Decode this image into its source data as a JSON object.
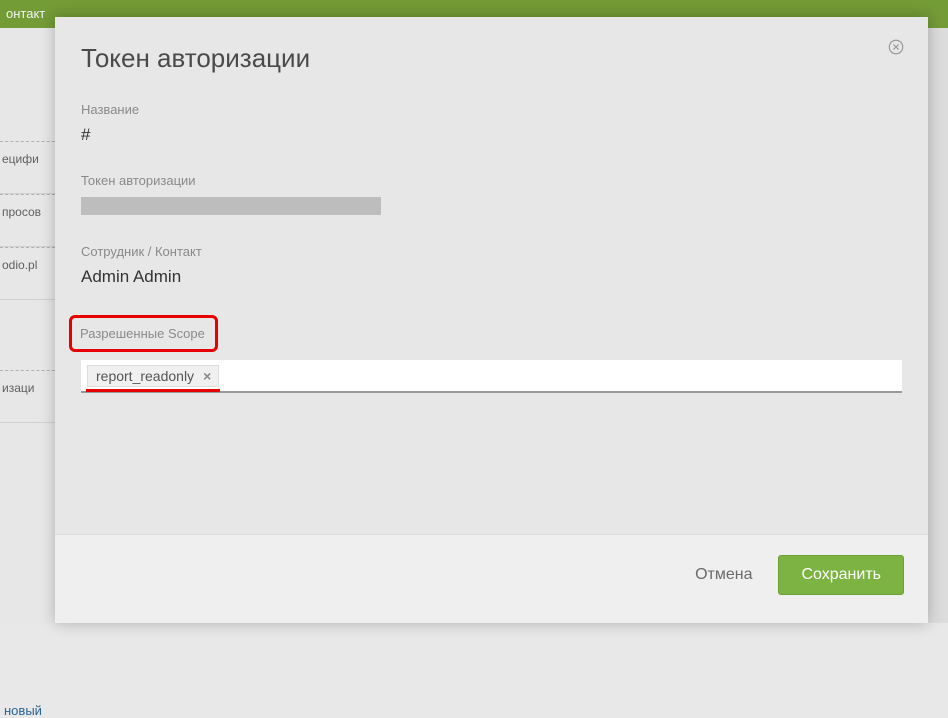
{
  "background": {
    "header_text": "онтакт",
    "sidebar_items": [
      "ецифи",
      "просов",
      "odio.pl",
      "изаци"
    ],
    "sidebar_link": "новый"
  },
  "modal": {
    "title": "Токен авторизации",
    "fields": {
      "name": {
        "label": "Название",
        "value": "#"
      },
      "token": {
        "label": "Токен авторизации",
        "value_redacted": true
      },
      "contact": {
        "label": "Сотрудник / Контакт",
        "value": "Admin Admin"
      },
      "scopes": {
        "label": "Разрешенные Scope",
        "tags": [
          "report_readonly"
        ]
      }
    },
    "buttons": {
      "cancel": "Отмена",
      "save": "Сохранить"
    }
  }
}
